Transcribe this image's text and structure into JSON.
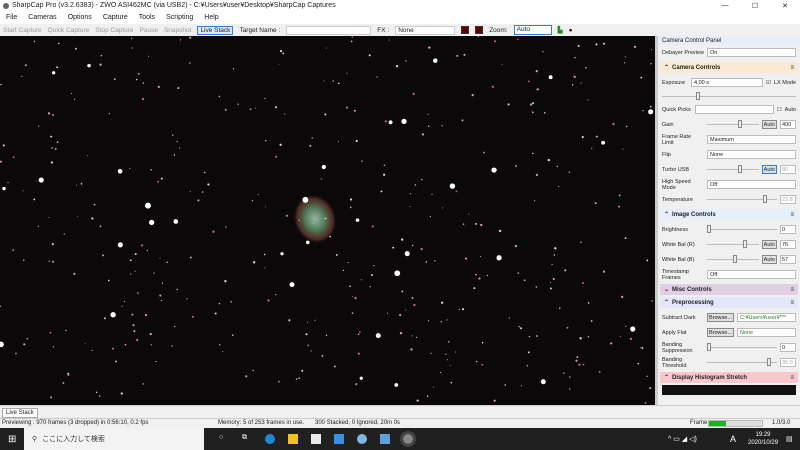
{
  "window": {
    "title": "SharpCap Pro (v3.2.6383) - ZWO ASI462MC (via USB2) - C:¥Users¥user¥Desktop¥SharpCap Captures",
    "minimize": "—",
    "maximize": "☐",
    "close": "✕"
  },
  "menu": [
    "File",
    "Cameras",
    "Options",
    "Capture",
    "Tools",
    "Scripting",
    "Help"
  ],
  "toolbar": {
    "start_capture": "Start Capture",
    "quick_capture": "Quick Capture",
    "stop_capture": "Stop Capture",
    "pause": "Pause",
    "snapshot": "Snapshot",
    "live_stack": "Live Stack",
    "target_name_label": "Target Name :",
    "target_name_value": "",
    "fx_label": "FX :",
    "fx_value": "None",
    "zoom_label": "Zoom:",
    "zoom_value": "Auto"
  },
  "panel": {
    "title": "Camera Control Panel",
    "debayer_label": "Debayer Preview",
    "debayer_value": "On",
    "camera_controls": {
      "title": "Camera Controls",
      "exposure_label": "Exposure",
      "exposure_value": "4.00 s",
      "lx_mode": "LX Mode",
      "quick_picks": "Quick Picks",
      "auto": "Auto",
      "gain_label": "Gain",
      "gain_value": "400",
      "frame_rate_label": "Frame Rate Limit",
      "frame_rate_value": "Maximum",
      "flip_label": "Flip",
      "flip_value": "None",
      "turbo_label": "Turbo USB",
      "turbo_value": "80",
      "hsm_label": "High Speed Mode",
      "hsm_value": "Off",
      "temp_label": "Temperature",
      "temp_value": "22.8"
    },
    "image_controls": {
      "title": "Image Controls",
      "brightness_label": "Brightness",
      "brightness_value": "0",
      "wbr_label": "White Bal (R)",
      "wbr_value": "76",
      "wbb_label": "White Bal (B)",
      "wbb_value": "57",
      "timestamp_label": "Timestamp Frames",
      "timestamp_value": "Off"
    },
    "misc_controls": {
      "title": "Misc Controls"
    },
    "preprocessing": {
      "title": "Preprocessing",
      "dark_label": "Subtract Dark",
      "browse": "Browse...",
      "dark_value": "C:¥Users¥user¥***",
      "flat_label": "Apply Flat",
      "flat_value": "None",
      "banding_sup_label": "Banding Suppression",
      "banding_sup_value": "0",
      "banding_thr_label": "Banding Threshold",
      "banding_thr_value": "35.0"
    },
    "histogram": {
      "title": "Display Histogram Stretch"
    }
  },
  "tab": "Live Stack",
  "status": {
    "preview": "Previewing : 970 frames (3 dropped) in 0:56:10, 0.2 fps",
    "memory": "Memory: 5 of 253 frames in use.",
    "stacked": "300 Stacked, 0 Ignored, 20m 0s",
    "frame_label": "Frame:",
    "frame_value": "1.0/3.0",
    "frame_progress": 0.33
  },
  "taskbar": {
    "search_placeholder": "ここに入力して検索",
    "time": "19:29",
    "date": "2020/10/29",
    "ime": "A"
  }
}
